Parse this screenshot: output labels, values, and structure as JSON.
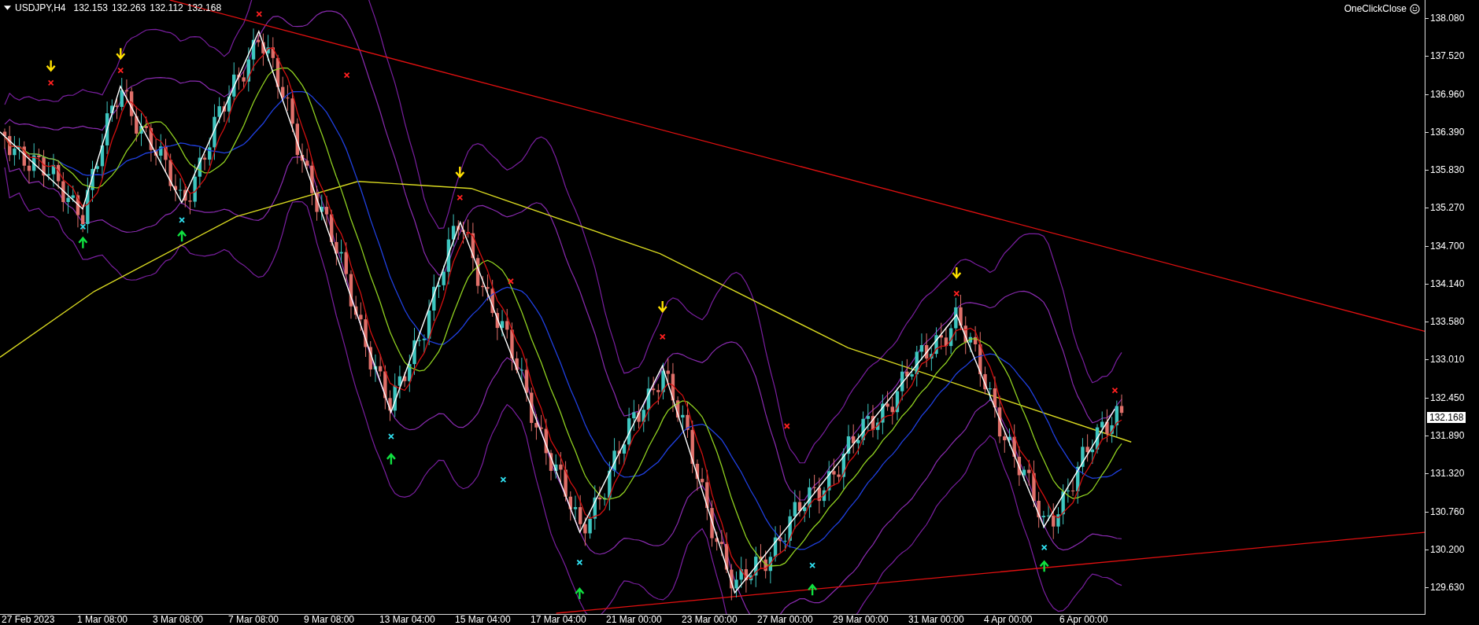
{
  "chart_header": {
    "symbol": "USDJPY,H4",
    "quotes": [
      "132.153",
      "132.263",
      "132.112",
      "132.168"
    ]
  },
  "expert": {
    "label": "OneClickClose"
  },
  "price_axis": {
    "labels": [
      "138.080",
      "137.520",
      "136.960",
      "136.390",
      "135.830",
      "135.270",
      "134.700",
      "134.140",
      "133.580",
      "133.010",
      "132.450",
      "131.890",
      "131.320",
      "130.760",
      "130.200",
      "129.630"
    ],
    "current_price": "132.168"
  },
  "time_axis": {
    "labels": [
      "27 Feb 2023",
      "1 Mar 08:00",
      "3 Mar 08:00",
      "7 Mar 08:00",
      "9 Mar 08:00",
      "13 Mar 04:00",
      "15 Mar 04:00",
      "17 Mar 04:00",
      "21 Mar 00:00",
      "23 Mar 00:00",
      "27 Mar 00:00",
      "29 Mar 00:00",
      "31 Mar 00:00",
      "4 Apr 00:00",
      "6 Apr 00:00"
    ]
  }
}
